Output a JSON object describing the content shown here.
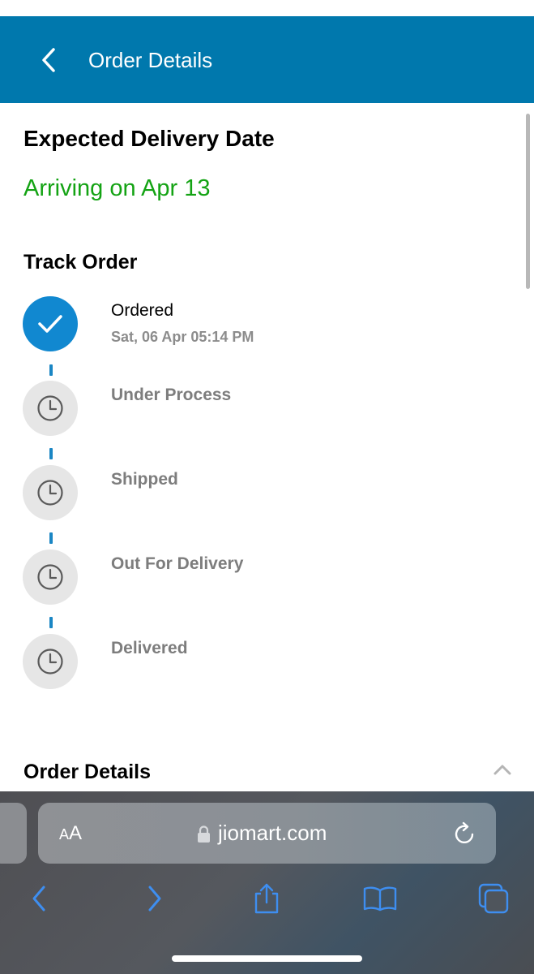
{
  "header": {
    "title": "Order Details",
    "color": "#0078ad"
  },
  "delivery": {
    "heading": "Expected Delivery Date",
    "arriving": "Arriving on Apr 13",
    "arriving_color": "#14a314"
  },
  "tracking": {
    "heading": "Track Order",
    "steps": [
      {
        "label": "Ordered",
        "time": "Sat, 06 Apr 05:14 PM",
        "status": "done",
        "icon": "check-icon"
      },
      {
        "label": "Under Process",
        "status": "pending",
        "icon": "clock-icon"
      },
      {
        "label": "Shipped",
        "status": "pending",
        "icon": "clock-icon"
      },
      {
        "label": "Out For Delivery",
        "status": "pending",
        "icon": "clock-icon"
      },
      {
        "label": "Delivered",
        "status": "pending",
        "icon": "clock-icon"
      }
    ]
  },
  "order_details": {
    "heading": "Order Details",
    "expanded": true
  },
  "browser": {
    "text_size_label_small": "A",
    "text_size_label_big": "A",
    "url": "jiomart.com",
    "toolbar": [
      "back-icon",
      "forward-icon",
      "share-icon",
      "bookmarks-icon",
      "tabs-icon"
    ]
  }
}
